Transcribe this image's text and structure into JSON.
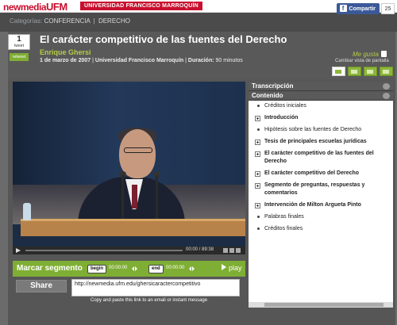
{
  "topbar": {
    "logo_newmedia": "newmedia",
    "logo_ufm": "UFM",
    "univ_prefix": "UNIVERSIDAD ",
    "univ_name": "FRANCISCO MARROQUÍN"
  },
  "categories": {
    "label": "Categorías:",
    "items": [
      "CONFERENCIA",
      "DERECHO"
    ],
    "separator": "|"
  },
  "facebook": {
    "label": "Compartir",
    "count": "25"
  },
  "tweet": {
    "count": "1",
    "label": "tweet",
    "retweet": "retweet"
  },
  "video_info": {
    "title": "El carácter competitivo de las fuentes del Derecho",
    "author": "Enrique Ghersi",
    "date": "1 de marzo de 2007",
    "institution": "Universidad Francisco Marroquín",
    "duration_label": "Duración:",
    "duration": "90 minutos"
  },
  "header_right": {
    "like": "Me gusta",
    "change_view": "Cambiar vista de pantalla",
    "view_options": [
      "view-layout-1",
      "view-layout-2",
      "view-layout-3",
      "view-layout-4"
    ],
    "selected_view": 0
  },
  "player": {
    "time": "00:00 / 89:38"
  },
  "segment": {
    "label": "Marcar segmento",
    "begin": "begin",
    "begin_time": "00:00:00",
    "end": "end",
    "end_time": "00:00:00",
    "play": "play"
  },
  "share": {
    "button": "Share",
    "url": "http://newmedia.ufm.edu/ghersicaractercompetitivo",
    "note": "Copy and paste this link to an email or instant message"
  },
  "sidebar": {
    "transcripcion": "Transcripción",
    "contenido": "Contenido",
    "items": [
      {
        "label": "Créditos iniciales",
        "type": "bullet"
      },
      {
        "label": "Introducción",
        "type": "plus"
      },
      {
        "label": "Hipótesis sobre las fuentes de Derecho",
        "type": "bullet"
      },
      {
        "label": "Tesis de principales escuelas jurídicas",
        "type": "plus"
      },
      {
        "label": "El carácter competitivo de las fuentes del Derecho",
        "type": "plus"
      },
      {
        "label": "El carácter competitivo del Derecho",
        "type": "plus"
      },
      {
        "label": "Segmento de preguntas, respuestas y comentarios",
        "type": "plus"
      },
      {
        "label": "Intervención de Milton Argueta Pinto",
        "type": "plus"
      },
      {
        "label": "Palabras finales",
        "type": "bullet"
      },
      {
        "label": "Créditos finales",
        "type": "bullet"
      }
    ]
  },
  "colors": {
    "brand_red": "#c8102e",
    "accent_green": "#7fae34",
    "author_green": "#b5cc45",
    "facebook_blue": "#3b5998"
  }
}
